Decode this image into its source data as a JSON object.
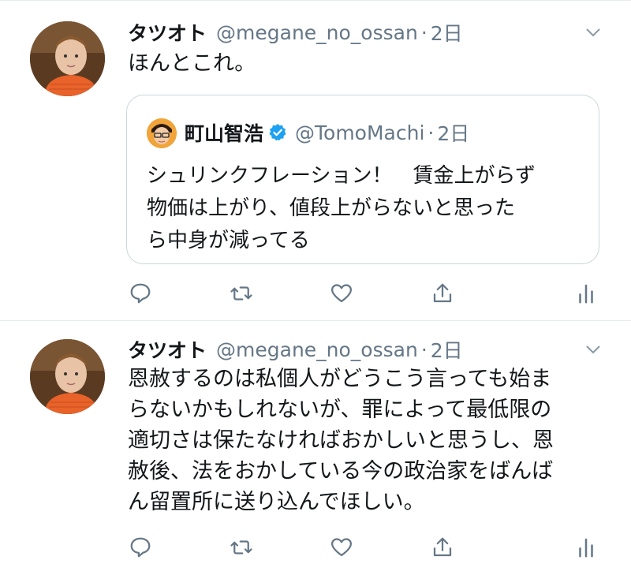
{
  "tweets": [
    {
      "name": "タツオト",
      "handle": "@megane_no_ossan",
      "separator": "·",
      "time": "2日",
      "text": "ほんとこれ。",
      "quoted": {
        "name": "町山智浩",
        "handle": "@TomoMachi",
        "separator": "·",
        "time": "2日",
        "lines": [
          "シュリンクフレーション！　賃金上がらず",
          "物価は上がり、値段上がらないと思った",
          "ら中身が減ってる"
        ]
      }
    },
    {
      "name": "タツオト",
      "handle": "@megane_no_ossan",
      "separator": "·",
      "time": "2日",
      "lines": [
        "恩赦するのは私個人がどうこう言っても始ま",
        "らないかもしれないが、罪によって最低限の",
        "適切さは保たなければおかしいと思うし、恩",
        "赦後、法をおかしている今の政治家をばんば",
        "ん留置所に送り込んでほしい。"
      ]
    }
  ],
  "icons": {
    "reply": "reply-icon",
    "retweet": "retweet-icon",
    "like": "like-icon",
    "share": "share-icon",
    "analytics": "analytics-icon",
    "caret": "chevron-down-icon",
    "verified": "verified-badge-icon"
  },
  "colors": {
    "text": "#14171a",
    "secondary": "#657786",
    "border": "#e6ecf0",
    "verified": "#1da1f2"
  }
}
